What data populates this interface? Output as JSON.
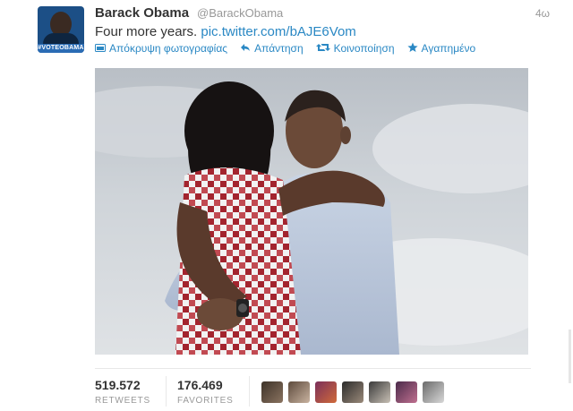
{
  "tweet": {
    "author_name": "Barack Obama",
    "handle": "@BarackObama",
    "time": "4ω",
    "text_plain": "Four more years.",
    "text_link": "pic.twitter.com/bAJE6Vom",
    "avatar": {
      "badge_text": "#VOTEOBAMA"
    }
  },
  "actions": [
    {
      "icon": "photo-icon",
      "label": "Απόκρυψη φωτογραφίας"
    },
    {
      "icon": "reply-icon",
      "label": "Απάντηση"
    },
    {
      "icon": "retweet-icon",
      "label": "Κοινοποίηση"
    },
    {
      "icon": "star-icon",
      "label": "Αγαπημένο"
    }
  ],
  "stats": {
    "retweets": {
      "value": "519.572",
      "label": "RETWEETS"
    },
    "favorites": {
      "value": "176.469",
      "label": "FAVORITES"
    }
  },
  "colors": {
    "link": "#2a88c4",
    "text": "#333333",
    "muted": "#999999"
  }
}
